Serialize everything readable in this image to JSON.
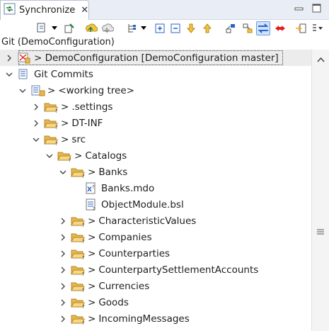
{
  "tab": {
    "title": "Synchronize",
    "close_glyph": "✕"
  },
  "window_buttons": [
    {
      "name": "minimize-button",
      "icon": "minimize-icon"
    },
    {
      "name": "maximize-button",
      "icon": "maximize-icon"
    }
  ],
  "toolbar": {
    "buttons": [
      {
        "name": "synchronize-button",
        "icon": "synchronize-icon",
        "dropdown": true
      },
      {
        "name": "pin-button",
        "icon": "pin-icon"
      },
      {
        "name": "fetch-button",
        "icon": "fetch-icon"
      },
      {
        "name": "push-button",
        "icon": "push-icon"
      },
      {
        "name": "presentation-button",
        "icon": "tree-presentation-icon",
        "dropdown": true
      },
      {
        "name": "expand-all-button",
        "icon": "expand-all-icon"
      },
      {
        "name": "collapse-all-button",
        "icon": "collapse-all-icon"
      },
      {
        "name": "next-difference-button",
        "icon": "arrow-down-icon"
      },
      {
        "name": "previous-difference-button",
        "icon": "arrow-up-icon"
      },
      {
        "name": "incoming-mode-button",
        "icon": "incoming-mode-icon"
      },
      {
        "name": "outgoing-mode-button",
        "icon": "outgoing-mode-icon"
      },
      {
        "name": "both-mode-button",
        "icon": "both-mode-icon",
        "active": true
      },
      {
        "name": "conflicts-mode-button",
        "icon": "conflicts-mode-icon"
      },
      {
        "name": "sync-link-button",
        "icon": "sync-link-icon"
      },
      {
        "name": "view-menu-button",
        "icon": "view-menu-icon"
      }
    ]
  },
  "git_label": "Git (DemoConfiguration)",
  "tree": [
    {
      "level": 0,
      "expanded": false,
      "icon": "git-repo-icon",
      "label": "> DemoConfiguration [DemoConfiguration master]",
      "selected": true
    },
    {
      "level": 0,
      "expanded": true,
      "icon": "git-commits-icon",
      "label": "Git Commits"
    },
    {
      "level": 1,
      "expanded": true,
      "icon": "working-tree-icon",
      "label": "<working tree>",
      "prefix": ">"
    },
    {
      "level": 2,
      "expanded": false,
      "icon": "folder-icon",
      "label": ".settings",
      "prefix": ">"
    },
    {
      "level": 2,
      "expanded": false,
      "icon": "folder-icon",
      "label": "DT-INF",
      "prefix": ">"
    },
    {
      "level": 2,
      "expanded": true,
      "icon": "folder-icon",
      "label": "src",
      "prefix": ">"
    },
    {
      "level": 3,
      "expanded": true,
      "icon": "folder-icon",
      "label": "Catalogs",
      "prefix": ">"
    },
    {
      "level": 4,
      "expanded": true,
      "icon": "folder-icon",
      "label": "Banks",
      "prefix": ">"
    },
    {
      "level": 5,
      "leaf": true,
      "icon": "mdo-file-icon",
      "label": "Banks.mdo"
    },
    {
      "level": 5,
      "leaf": true,
      "icon": "bsl-file-icon",
      "label": "ObjectModule.bsl"
    },
    {
      "level": 4,
      "expanded": false,
      "icon": "folder-icon",
      "label": "CharacteristicValues",
      "prefix": ">"
    },
    {
      "level": 4,
      "expanded": false,
      "icon": "folder-icon",
      "label": "Companies",
      "prefix": ">"
    },
    {
      "level": 4,
      "expanded": false,
      "icon": "folder-icon",
      "label": "Counterparties",
      "prefix": ">"
    },
    {
      "level": 4,
      "expanded": false,
      "icon": "folder-icon",
      "label": "CounterpartySettlementAccounts",
      "prefix": ">"
    },
    {
      "level": 4,
      "expanded": false,
      "icon": "folder-icon",
      "label": "Currencies",
      "prefix": ">"
    },
    {
      "level": 4,
      "expanded": false,
      "icon": "folder-icon",
      "label": "Goods",
      "prefix": ">"
    },
    {
      "level": 4,
      "expanded": false,
      "icon": "folder-icon",
      "label": "IncomingMessages",
      "prefix": ">"
    }
  ],
  "colors": {
    "folder": "#e8b84a",
    "folder_edge": "#b5862a",
    "selection": "#ececec",
    "toolbar_active": "#cfe3ff",
    "accent_blue": "#2b63c6",
    "conflict_red": "#e02020"
  }
}
